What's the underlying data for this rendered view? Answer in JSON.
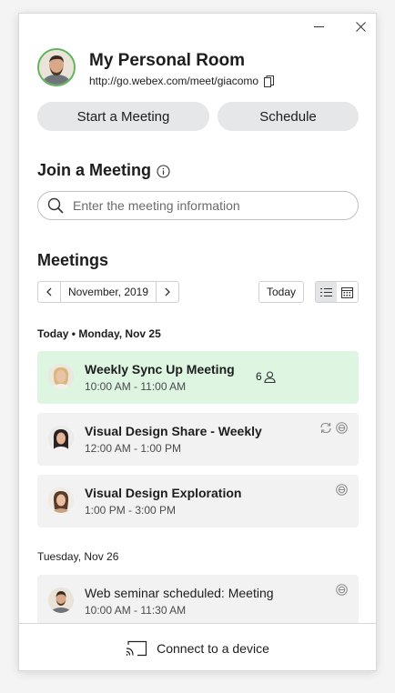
{
  "room": {
    "title": "My Personal Room",
    "url": "http://go.webex.com/meet/giacomo"
  },
  "actions": {
    "start_label": "Start a Meeting",
    "schedule_label": "Schedule"
  },
  "join": {
    "title": "Join a Meeting",
    "placeholder": "Enter the meeting information"
  },
  "meetings": {
    "title": "Meetings",
    "month": "November, 2019",
    "today_label": "Today",
    "view_mode": "list"
  },
  "days": [
    {
      "label": "Today • Monday, Nov 25",
      "items": [
        {
          "title": "Weekly Sync Up Meeting",
          "time": "10:00 AM - 11:00 AM",
          "attendees": "6",
          "highlighted": true,
          "avatar": "woman-blonde"
        },
        {
          "title": "Visual Design Share - Weekly",
          "time": "12:00 AM - 1:00 PM",
          "icons": [
            "recurring-icon",
            "webex-icon"
          ],
          "avatar": "woman-dark-hair"
        },
        {
          "title": "Visual Design Exploration",
          "time": "1:00 PM - 3:00 PM",
          "icons": [
            "webex-icon"
          ],
          "avatar": "woman-brunette"
        }
      ]
    },
    {
      "label": "Tuesday, Nov 26",
      "items": [
        {
          "title": "Web seminar scheduled: Meeting",
          "time": "10:00 AM - 11:30 AM",
          "icons": [
            "webex-icon"
          ],
          "avatar": "man-beard"
        }
      ]
    }
  ],
  "footer": {
    "connect_label": "Connect to a device",
    "icon": "cast-icon"
  },
  "colors": {
    "active_card": "#def5e1",
    "card": "#f2f2f3",
    "button": "#e6e7e8",
    "avatar_ring": "#5fb55a"
  }
}
